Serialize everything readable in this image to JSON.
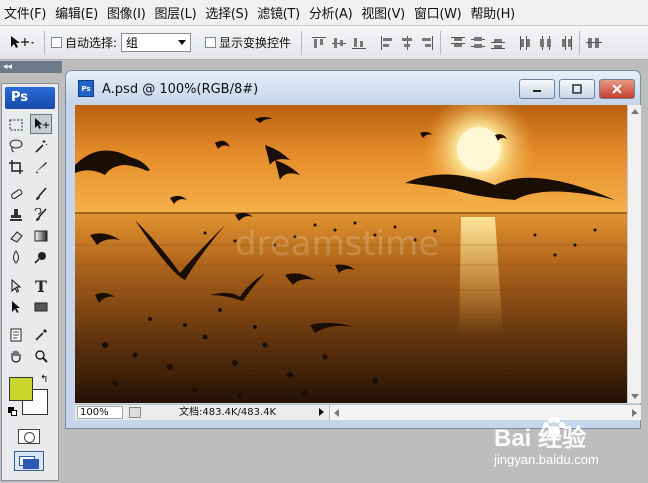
{
  "menubar": {
    "items": [
      "文件(F)",
      "编辑(E)",
      "图像(I)",
      "图层(L)",
      "选择(S)",
      "滤镜(T)",
      "分析(A)",
      "视图(V)",
      "窗口(W)",
      "帮助(H)"
    ]
  },
  "options": {
    "auto_select_label": "自动选择:",
    "auto_select_value": "组",
    "show_transform_label": "显示变换控件"
  },
  "toolbox": {
    "logo": "Ps",
    "collapse_label": "◂◂"
  },
  "document": {
    "title": "A.psd @ 100%(RGB/8#)",
    "zoom": "100%",
    "doc_size": "文档:483.4K/483.4K",
    "watermark_text": "dreamstime",
    "colors": {
      "sky_top": "#c66a12",
      "sky_mid": "#f0a03a",
      "sun": "#fff6c8",
      "sea_mid": "#9a5114",
      "sea_dark": "#2b1606"
    }
  },
  "brand_watermark": {
    "logo": "Bai  经验",
    "url": "jingyan.baidu.com"
  }
}
